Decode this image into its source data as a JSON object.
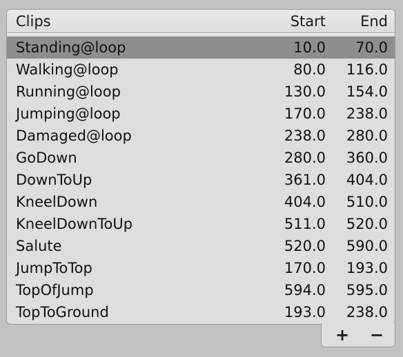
{
  "header": {
    "clips": "Clips",
    "start": "Start",
    "end": "End"
  },
  "clips": [
    {
      "name": "Standing@loop",
      "start": "10.0",
      "end": "70.0",
      "selected": true
    },
    {
      "name": "Walking@loop",
      "start": "80.0",
      "end": "116.0"
    },
    {
      "name": "Running@loop",
      "start": "130.0",
      "end": "154.0"
    },
    {
      "name": "Jumping@loop",
      "start": "170.0",
      "end": "238.0"
    },
    {
      "name": "Damaged@loop",
      "start": "238.0",
      "end": "280.0"
    },
    {
      "name": "GoDown",
      "start": "280.0",
      "end": "360.0"
    },
    {
      "name": "DownToUp",
      "start": "361.0",
      "end": "404.0"
    },
    {
      "name": "KneelDown",
      "start": "404.0",
      "end": "510.0"
    },
    {
      "name": "KneelDownToUp",
      "start": "511.0",
      "end": "520.0"
    },
    {
      "name": "Salute",
      "start": "520.0",
      "end": "590.0"
    },
    {
      "name": "JumpToTop",
      "start": "170.0",
      "end": "193.0"
    },
    {
      "name": "TopOfJump",
      "start": "594.0",
      "end": "595.0"
    },
    {
      "name": "TopToGround",
      "start": "193.0",
      "end": "238.0"
    }
  ],
  "footer": {
    "add_label": "+",
    "remove_label": "−"
  },
  "colors": {
    "background": "#c2c2c2",
    "panel": "#dedede",
    "selected_row": "#8e8e8e"
  }
}
